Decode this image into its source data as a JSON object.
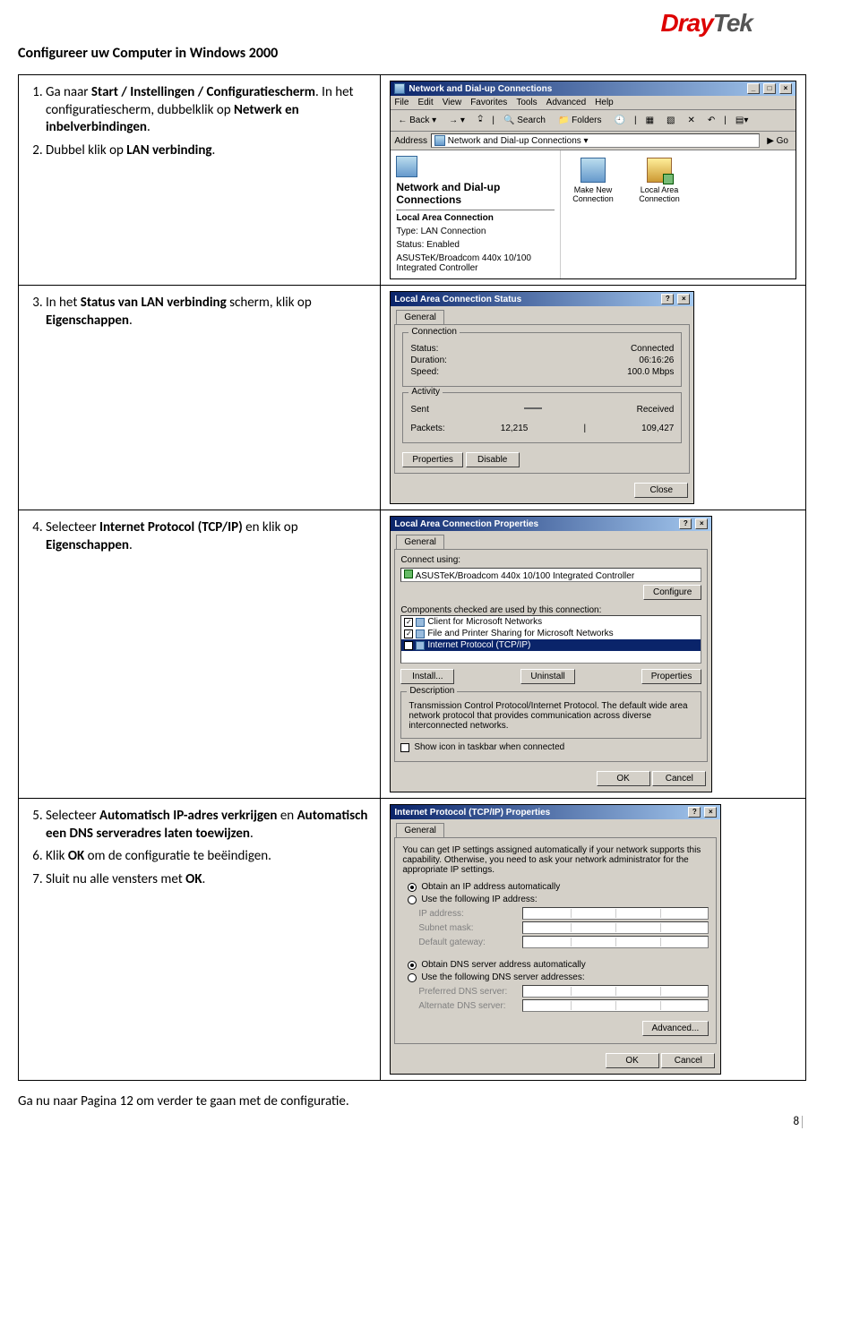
{
  "logo": {
    "part1": "Dray",
    "part2": "Tek"
  },
  "page_title": "Configureer uw Computer in Windows 2000",
  "steps": {
    "s1a": "Ga naar ",
    "s1b": "Start / Instellingen / Configuratiescherm",
    "s1c": ". In het configuratiescherm, dubbelklik op ",
    "s1d": "Netwerk en inbelverbindingen",
    "s1e": ".",
    "s2a": "Dubbel klik op ",
    "s2b": "LAN verbinding",
    "s2c": ".",
    "s3a": "In het ",
    "s3b": "Status van LAN verbinding",
    "s3c": " scherm, klik op ",
    "s3d": "Eigenschappen",
    "s3e": ".",
    "s4a": "Selecteer ",
    "s4b": "Internet Protocol (TCP/IP)",
    "s4c": " en klik op ",
    "s4d": "Eigenschappen",
    "s4e": ".",
    "s5a": "Selecteer ",
    "s5b": "Automatisch IP-adres verkrijgen",
    "s5c": " en ",
    "s5d": "Automatisch een DNS serveradres laten toewijzen",
    "s5e": ".",
    "s6a": "Klik ",
    "s6b": "OK",
    "s6c": " om de configuratie te beëindigen.",
    "s7a": "Sluit nu alle vensters met ",
    "s7b": "OK",
    "s7c": "."
  },
  "explorer": {
    "title": "Network and Dial-up Connections",
    "menu": [
      "File",
      "Edit",
      "View",
      "Favorites",
      "Tools",
      "Advanced",
      "Help"
    ],
    "back": "Back",
    "search": "Search",
    "folders": "Folders",
    "addr_label": "Address",
    "addr_value": "Network and Dial-up Connections",
    "go": "Go",
    "left_title": "Network and Dial-up Connections",
    "lac_label": "Local Area Connection",
    "type_lbl": "Type:",
    "type_val": "LAN Connection",
    "status_lbl": "Status:",
    "status_val": "Enabled",
    "nic": "ASUSTeK/Broadcom 440x 10/100 Integrated Controller",
    "icon_new": "Make New Connection",
    "icon_lan": "Local Area Connection"
  },
  "lacstatus": {
    "title": "Local Area Connection Status",
    "tab": "General",
    "grp_conn": "Connection",
    "status_l": "Status:",
    "status_v": "Connected",
    "dur_l": "Duration:",
    "dur_v": "06:16:26",
    "spd_l": "Speed:",
    "spd_v": "100.0 Mbps",
    "grp_act": "Activity",
    "sent": "Sent",
    "recv": "Received",
    "pkt_l": "Packets:",
    "pkt_sent": "12,215",
    "pkt_recv": "109,427",
    "btn_props": "Properties",
    "btn_dis": "Disable",
    "btn_close": "Close"
  },
  "lacprops": {
    "title": "Local Area Connection Properties",
    "tab": "General",
    "connect_using": "Connect using:",
    "nic": "ASUSTeK/Broadcom 440x 10/100 Integrated Controller",
    "btn_cfg": "Configure",
    "comp_lbl": "Components checked are used by this connection:",
    "items": [
      "Client for Microsoft Networks",
      "File and Printer Sharing for Microsoft Networks",
      "Internet Protocol (TCP/IP)"
    ],
    "btn_install": "Install...",
    "btn_uninstall": "Uninstall",
    "btn_props": "Properties",
    "desc_lbl": "Description",
    "desc": "Transmission Control Protocol/Internet Protocol. The default wide area network protocol that provides communication across diverse interconnected networks.",
    "showicon": "Show icon in taskbar when connected",
    "ok": "OK",
    "cancel": "Cancel"
  },
  "tcpip": {
    "title": "Internet Protocol (TCP/IP) Properties",
    "tab": "General",
    "blurb": "You can get IP settings assigned automatically if your network supports this capability. Otherwise, you need to ask your network administrator for the appropriate IP settings.",
    "r1": "Obtain an IP address automatically",
    "r2": "Use the following IP address:",
    "ip_l": "IP address:",
    "mask_l": "Subnet mask:",
    "gw_l": "Default gateway:",
    "r3": "Obtain DNS server address automatically",
    "r4": "Use the following DNS server addresses:",
    "pdns": "Preferred DNS server:",
    "adns": "Alternate DNS server:",
    "adv": "Advanced...",
    "ok": "OK",
    "cancel": "Cancel"
  },
  "footer": "Ga nu naar Pagina 12 om verder te gaan met de configuratie.",
  "pagenum": "8"
}
